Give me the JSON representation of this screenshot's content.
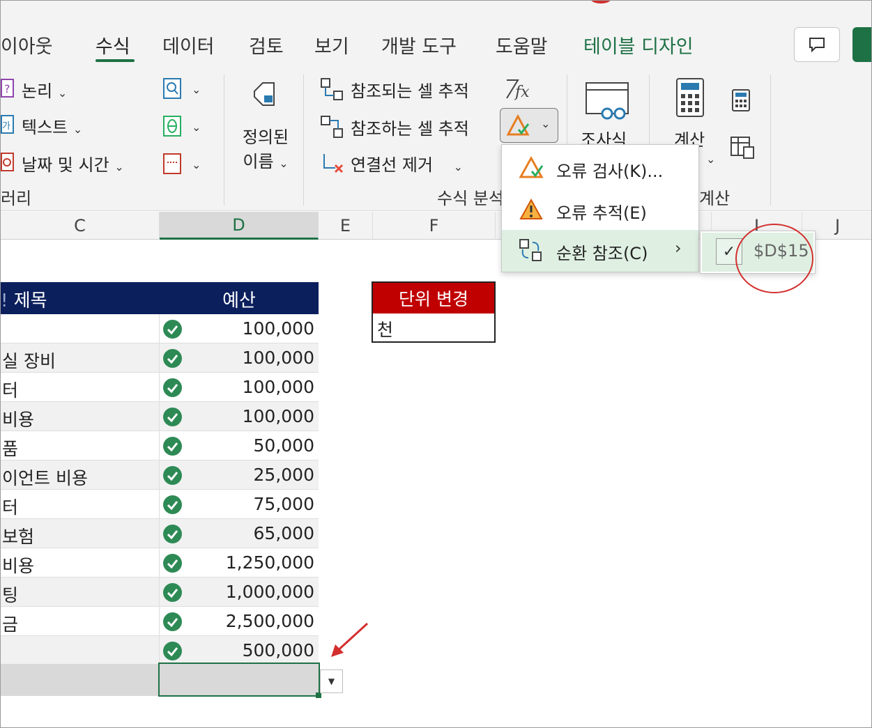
{
  "ribbon_tabs": {
    "layout": "이아웃",
    "formulas": "수식",
    "data": "데이터",
    "review": "검토",
    "view": "보기",
    "developer": "개발 도구",
    "help": "도움말",
    "table_design": "테이블 디자인"
  },
  "function_library": {
    "logical": "논리",
    "text": "텍스트",
    "datetime": "날짜 및 시간",
    "group_label": "러리"
  },
  "defined_names": {
    "line1": "정의된",
    "line2": "이름"
  },
  "formula_auditing": {
    "trace_precedents": "참조되는 셀 추적",
    "trace_dependents": "참조하는 셀 추적",
    "remove_arrows": "연결선 제거",
    "group_label": "수식 분석",
    "watch_window": "조사식"
  },
  "calculation": {
    "calc_options": "계산",
    "group_label": "계산"
  },
  "columns": {
    "c": "C",
    "d": "D",
    "e": "E",
    "f": "F",
    "i": "I",
    "j": "J"
  },
  "table": {
    "header_title": "제목",
    "header_budget": "예산",
    "rows": [
      {
        "title": "",
        "value": "100,000"
      },
      {
        "title": "실 장비",
        "value": "100,000"
      },
      {
        "title": "터",
        "value": "100,000"
      },
      {
        "title": " 비용",
        "value": "100,000"
      },
      {
        "title": "품",
        "value": "50,000"
      },
      {
        "title": "이언트 비용",
        "value": "25,000"
      },
      {
        "title": "터",
        "value": "75,000"
      },
      {
        "title": " 보험",
        "value": "65,000"
      },
      {
        "title": " 비용",
        "value": "1,250,000"
      },
      {
        "title": "팅",
        "value": "1,000,000"
      },
      {
        "title": "금",
        "value": "2,500,000"
      },
      {
        "title": "",
        "value": "500,000"
      }
    ]
  },
  "unit_box": {
    "header": "단위 변경",
    "value": "천"
  },
  "error_menu": {
    "error_checking": "오류 검사(K)...",
    "trace_error": "오류 추적(E)",
    "circular_refs": "순환 참조(C)"
  },
  "submenu": {
    "circular_cell": "$D$15"
  },
  "colors": {
    "accent": "#1e7145",
    "table_header": "#0b1f5c",
    "unit_header": "#c00000",
    "annotation": "#d32f2f"
  }
}
